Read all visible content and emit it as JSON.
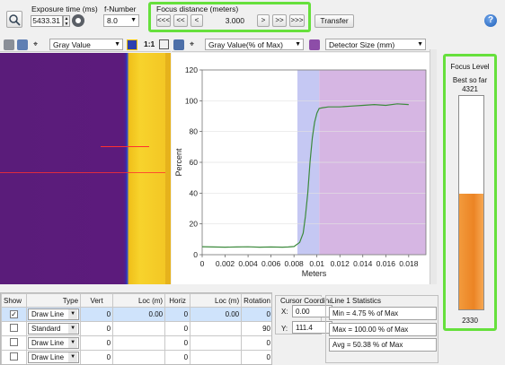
{
  "toolbar": {
    "exposure_label": "Exposure time (ms)",
    "exposure_value": "5433.31",
    "fnumber_label": "f-Number",
    "fnumber_value": "8.0",
    "focus_label": "Focus distance (meters)",
    "focus_buttons": [
      "<<<",
      "<<",
      "<",
      "3.000",
      ">",
      ">>",
      ">>>"
    ],
    "transfer_label": "Transfer"
  },
  "image_panel": {
    "combo_value": "Gray Value",
    "zoom_label": "1:1"
  },
  "plot_panel": {
    "combo_y": "Gray Value(% of Max)",
    "combo_x": "Detector Size (mm)"
  },
  "chart_data": {
    "type": "line",
    "xlabel": "Meters",
    "ylabel": "Percent",
    "xlim": [
      0,
      0.0195
    ],
    "ylim": [
      0,
      120
    ],
    "x_ticks": [
      "0",
      "0.002",
      "0.004",
      "0.006",
      "0.008",
      "0.01",
      "0.012",
      "0.014",
      "0.016",
      "0.018"
    ],
    "y_ticks": [
      "0",
      "20",
      "40",
      "60",
      "80",
      "100",
      "120"
    ],
    "shaded_regions": [
      {
        "from": 0.0083,
        "to": 0.0102,
        "color": "#c5c8f3"
      },
      {
        "from": 0.0102,
        "to": 0.0195,
        "color": "#d6b6e3"
      }
    ],
    "series": [
      {
        "color": "#3c8a3c",
        "x": [
          0,
          0.001,
          0.002,
          0.003,
          0.004,
          0.005,
          0.006,
          0.007,
          0.0075,
          0.008,
          0.0085,
          0.0088,
          0.009,
          0.0092,
          0.0094,
          0.0096,
          0.0098,
          0.01,
          0.0102,
          0.0105,
          0.011,
          0.012,
          0.013,
          0.014,
          0.015,
          0.016,
          0.017,
          0.018
        ],
        "y": [
          5.2,
          5.0,
          4.9,
          5.0,
          5.1,
          4.9,
          5.0,
          4.9,
          5.0,
          5.3,
          8,
          14,
          25,
          40,
          60,
          76,
          86,
          92,
          95,
          95.5,
          96,
          96,
          96.5,
          97,
          97.5,
          97,
          98,
          97.5
        ]
      }
    ]
  },
  "row_table": {
    "headers": [
      "Show",
      "Type",
      "Vert",
      "Loc (m)",
      "Horiz",
      "Loc (m)",
      "Rotation"
    ],
    "rows": [
      {
        "type": "Draw Line",
        "vert": "0",
        "loc1": "0.00",
        "horiz": "0",
        "loc2": "0.00",
        "rotation": "0",
        "checked": true
      },
      {
        "type": "Standard",
        "vert": "0",
        "loc1": "",
        "horiz": "0",
        "loc2": "",
        "rotation": "90",
        "checked": false
      },
      {
        "type": "Draw Line",
        "vert": "0",
        "loc1": "",
        "horiz": "0",
        "loc2": "",
        "rotation": "0",
        "checked": false
      },
      {
        "type": "Draw Line",
        "vert": "0",
        "loc1": "",
        "horiz": "0",
        "loc2": "",
        "rotation": "0",
        "checked": false
      }
    ]
  },
  "cursor": {
    "title": "Cursor Coordinates",
    "x_label": "X:",
    "x_value": "0.00",
    "y_label": "Y:",
    "y_value": "111.4"
  },
  "stats": {
    "title": "Line 1 Statistics",
    "min": "Min = 4.75 % of Max",
    "max": "Max = 100.00 % of Max",
    "avg": "Avg = 50.38 % of Max"
  },
  "focus_level": {
    "title": "Focus Level",
    "best_label": "Best so far",
    "best_value": "4321",
    "current_value": "2330",
    "fill_fraction": 0.54,
    "fill_color": "#ee8a2c"
  }
}
